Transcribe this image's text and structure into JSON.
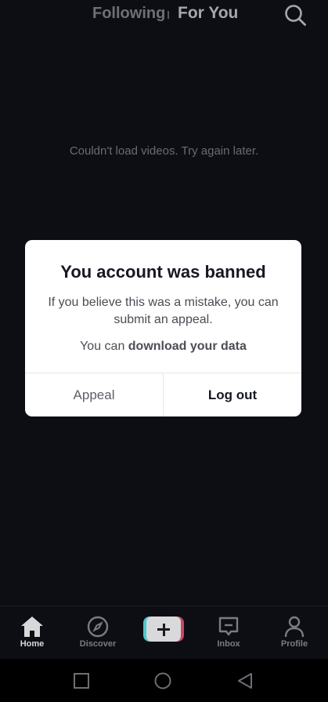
{
  "topbar": {
    "following_label": "Following",
    "foryou_label": "For You"
  },
  "feed": {
    "message": "Couldn't load videos. Try again later."
  },
  "modal": {
    "title": "You account was banned",
    "body": "If you believe this was a mistake, you can submit an appeal.",
    "data_prefix": "You can ",
    "data_link": "download your data",
    "appeal_label": "Appeal",
    "logout_label": "Log out"
  },
  "bottom_nav": {
    "home_label": "Home",
    "discover_label": "Discover",
    "inbox_label": "Inbox",
    "profile_label": "Profile"
  },
  "icons": {
    "search": "search-icon",
    "home": "home-icon",
    "discover": "compass-icon",
    "create": "plus-icon",
    "inbox": "message-icon",
    "profile": "person-icon",
    "recent_apps": "square-icon",
    "home_system": "circle-icon",
    "back": "triangle-back-icon"
  },
  "colors": {
    "background": "#0d0e14",
    "modal_bg": "#ffffff",
    "create_left": "#4fc8c9",
    "create_right": "#c94763"
  }
}
